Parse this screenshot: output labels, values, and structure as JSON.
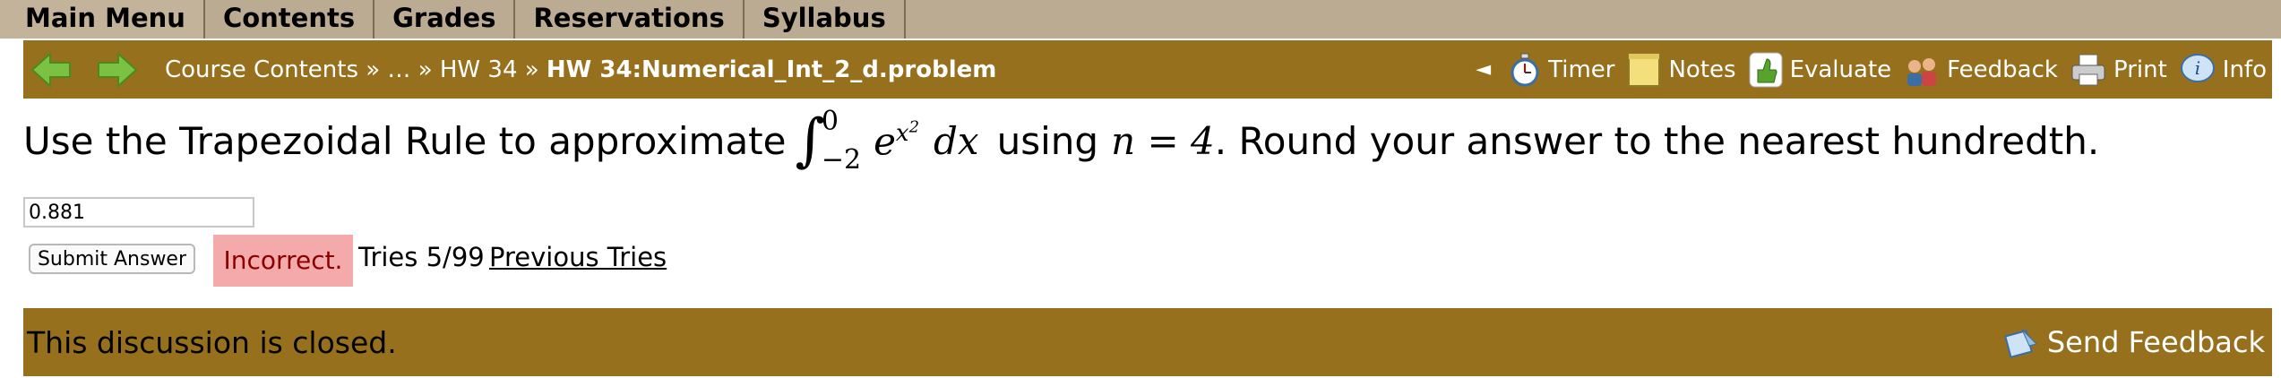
{
  "menu": [
    "Main Menu",
    "Contents",
    "Grades",
    "Reservations",
    "Syllabus"
  ],
  "breadcrumb": {
    "part1": "Course Contents",
    "sep1": " » … » ",
    "part2": "HW 34",
    "sep2": " » ",
    "current": "HW 34:Numerical_Int_2_d.problem"
  },
  "tools": {
    "collapse": "◄",
    "timer": "Timer",
    "notes": "Notes",
    "evaluate": "Evaluate",
    "feedback": "Feedback",
    "print": "Print",
    "info": "Info"
  },
  "problem": {
    "before": "Use the Trapezoidal Rule to approximate",
    "upper": "0",
    "lower": "−2",
    "integrand_base": "e",
    "integrand_exp": "x",
    "integrand_exp2": "2",
    "dx": "dx",
    "middle": "using",
    "n_expr": "n = 4",
    "after": ". Round your answer to the nearest hundredth."
  },
  "answer": {
    "value": "0.881"
  },
  "submit_label": "Submit Answer",
  "status": "Incorrect.",
  "tries": "Tries 5/99",
  "previous_tries": "Previous Tries",
  "discussion": {
    "text": "This discussion is closed.",
    "send_feedback": "Send Feedback"
  },
  "colors": {
    "menu_bg": "#bcab93",
    "nav_bg": "#97701d",
    "incorrect_bg": "#f4a9aa"
  }
}
